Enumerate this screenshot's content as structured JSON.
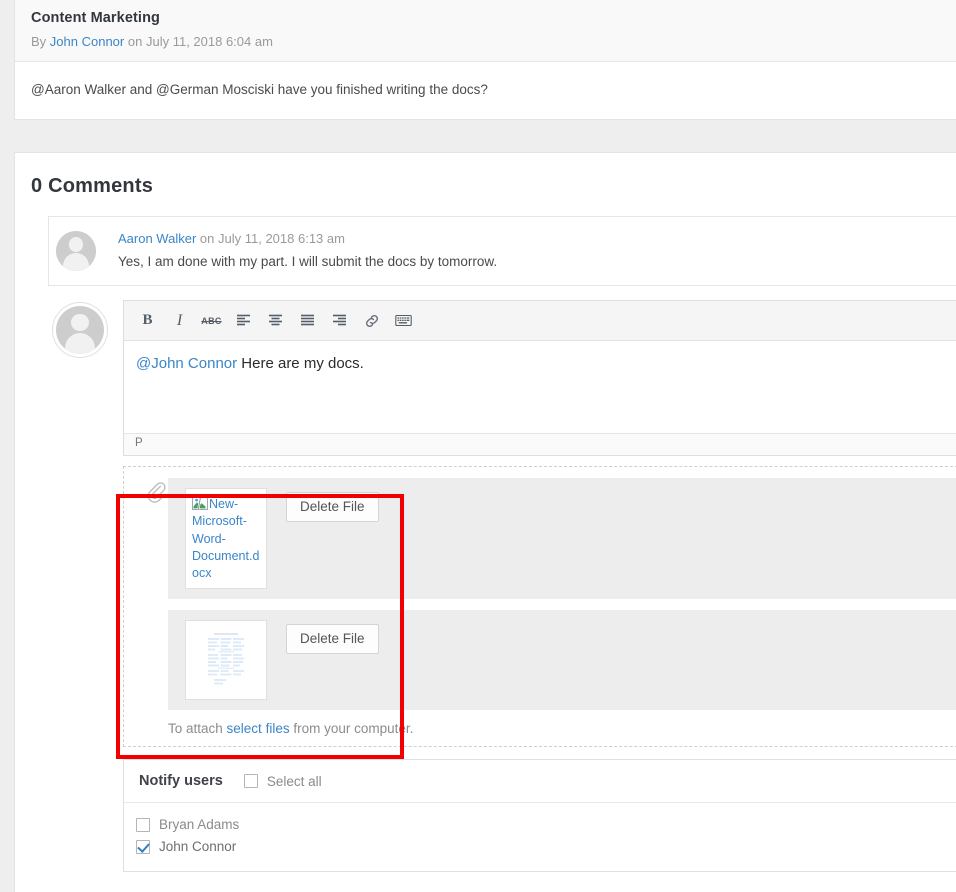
{
  "post": {
    "title": "Content Marketing",
    "meta_prefix": "By",
    "author": "John Connor",
    "meta_middle": "on",
    "date": "July 11, 2018 6:04 am",
    "body": "@Aaron Walker and @German Mosciski have you finished writing the docs?"
  },
  "comments": {
    "heading": "0 Comments",
    "items": [
      {
        "author": "Aaron Walker",
        "meta_middle": "on",
        "date": "July 11, 2018 6:13 am",
        "body": "Yes, I am done with my part. I will submit the docs by tomorrow."
      }
    ]
  },
  "composer": {
    "toolbar": [
      {
        "name": "bold-icon",
        "label": "B"
      },
      {
        "name": "italic-icon",
        "label": "I"
      },
      {
        "name": "strikethrough-icon",
        "label": "ABC"
      },
      {
        "name": "align-left-icon",
        "label": ""
      },
      {
        "name": "align-center-icon",
        "label": ""
      },
      {
        "name": "align-justify-icon",
        "label": ""
      },
      {
        "name": "align-right-icon",
        "label": ""
      },
      {
        "name": "link-icon",
        "label": ""
      },
      {
        "name": "keyboard-shortcuts-icon",
        "label": ""
      }
    ],
    "editor": {
      "mention": "@John Connor",
      "text": " Here are my docs.",
      "status_path": "P"
    },
    "attachments": {
      "files": [
        {
          "name": "New-Microsoft-Word-Document.docx",
          "thumb_type": "broken-image",
          "delete_label": "Delete File"
        },
        {
          "name": "",
          "thumb_type": "document-preview",
          "delete_label": "Delete File"
        }
      ],
      "hint_before": "To attach ",
      "hint_link": "select files",
      "hint_after": " from your computer."
    },
    "notify": {
      "title": "Notify users",
      "select_all_label": "Select all",
      "select_all_checked": false,
      "users": [
        {
          "name": "Bryan Adams",
          "checked": false
        },
        {
          "name": "John Connor",
          "checked": true
        }
      ]
    }
  },
  "annotation": {
    "highlight_color": "#f20000"
  }
}
